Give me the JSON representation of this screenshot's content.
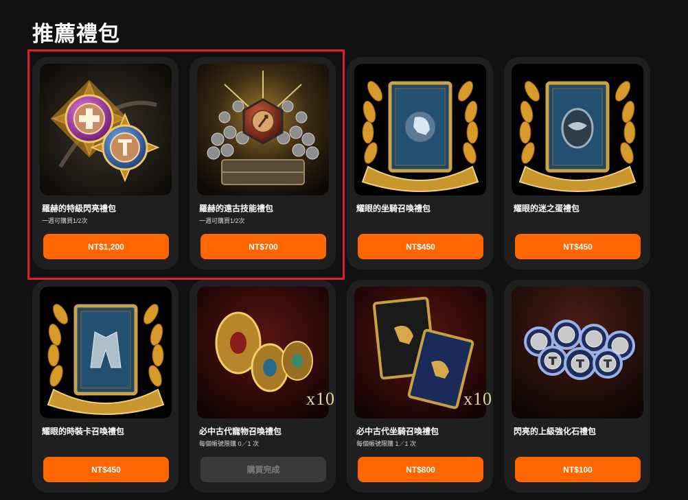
{
  "page": {
    "title": "推薦禮包"
  },
  "colors": {
    "accent": "#ff6600",
    "disabled_button": "#3a3a3a",
    "highlight_border": "#e01e2a",
    "card_bg": "#1f1f1f"
  },
  "packages": [
    {
      "name": "羅赫的特級閃亮禮包",
      "limit": "一週可購買1/2次",
      "button": "NT$1,200",
      "icon": "crossed-medallions-icon"
    },
    {
      "name": "羅赫的遠古技能禮包",
      "limit": "一週可購買1/2次",
      "button": "NT$700",
      "icon": "ancient-gem-treasure-icon"
    },
    {
      "name": "耀眼的坐騎召喚禮包",
      "limit": "",
      "button": "NT$450",
      "icon": "mount-card-laurel-icon"
    },
    {
      "name": "耀眼的迷之蛋禮包",
      "limit": "",
      "button": "NT$450",
      "icon": "mystery-egg-card-laurel-icon"
    },
    {
      "name": "耀眼的時裝卡召喚禮包",
      "limit": "",
      "button": "NT$450",
      "icon": "costume-card-laurel-icon"
    },
    {
      "name": "必中古代寵物召喚禮包",
      "limit": "每個帳號限購 0／1 次",
      "button": "購買完成",
      "icon": "golden-eggs-x10-icon"
    },
    {
      "name": "必中古代坐騎召喚禮包",
      "limit": "每個帳號限購 1／1 次",
      "button": "NT$800",
      "icon": "mount-cards-x10-icon"
    },
    {
      "name": "閃亮的上級強化石禮包",
      "limit": "",
      "button": "NT$100",
      "icon": "enhance-stones-icon"
    }
  ],
  "badge_x10": "x10"
}
